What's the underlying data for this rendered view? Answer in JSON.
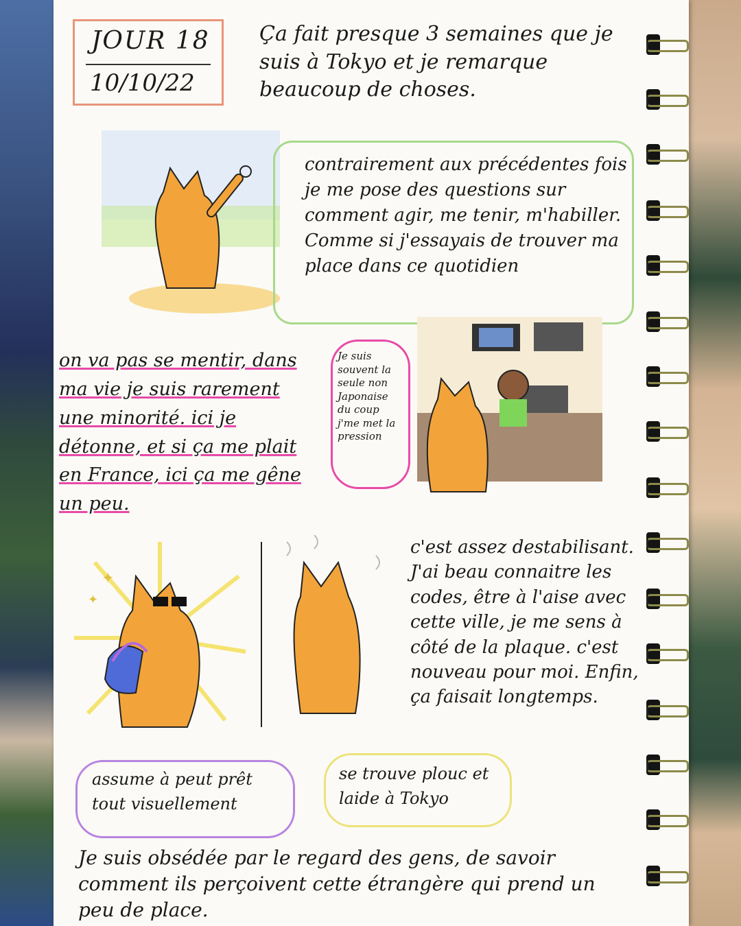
{
  "header": {
    "day_label": "JOUR 18",
    "date": "10/10/22"
  },
  "intro_text": "Ça fait presque 3 semaines que je suis à Tokyo et je remarque beaucoup de choses.",
  "panel1": {
    "text": "contrairement aux précédentes fois je me pose des questions sur comment agir, me tenir, m'habiller. Comme si j'essayais de trouver ma place dans ce quotidien"
  },
  "panel2": {
    "text": "on va pas se mentir, dans ma vie je suis rarement une minorité. ici je détonne, et si ça me plait en France, ici ça me gêne un peu.",
    "bubble": "Je suis souvent la seule non Japonaise du coup j'me met la pression"
  },
  "panel3": {
    "text": "c'est assez destabilisant. J'ai beau connaitre les codes, être à l'aise avec cette ville, je me sens à côté de la plaque. c'est nouveau pour moi. Enfin, ça faisait longtemps.",
    "caption_left": "assume à peut prêt tout visuellement",
    "caption_right": "se trouve plouc et laide à Tokyo"
  },
  "footer_text": "Je suis obsédée par le regard des gens, de savoir comment ils perçoivent cette étrangère qui prend un peu de place.",
  "colors": {
    "date_box": "#e8957a",
    "green_bubble": "#a7d98a",
    "pink_bubble": "#e84aa8",
    "purple_bubble": "#b784e0",
    "yellow_bubble": "#ece27a",
    "character": "#f2a43a"
  }
}
